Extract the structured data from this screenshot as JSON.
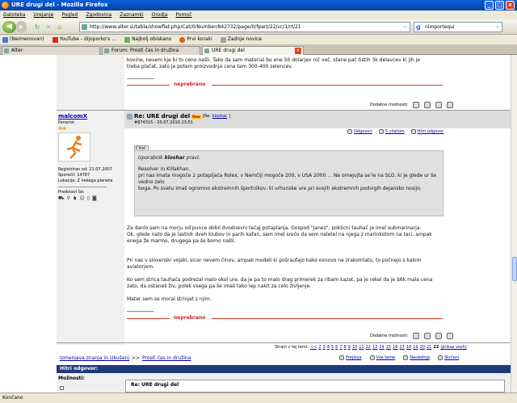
{
  "window": {
    "title": "URE drugi del - Mozilla Firefox"
  },
  "menu": [
    "Datoteka",
    "Urejanje",
    "Pogled",
    "Zgodovina",
    "Zaznamki",
    "Orodja",
    "Pomoč"
  ],
  "navbar": {
    "url": "http://www.alter.si/tabla/showflat.php/Cat/0/Number/842732/page/0/fpart/22/vc/1/rt/21",
    "search_value": "nimportequi"
  },
  "bookmarks": [
    {
      "label": "(Neimenovan)",
      "color": "#4a7bd0"
    },
    {
      "label": "YouTube - dijoporko's ...",
      "color": "#d22"
    },
    {
      "label": "Najbolj obiskano",
      "color": "#7a6"
    },
    {
      "label": "Prvi koraki",
      "color": "#e55b13"
    },
    {
      "label": "Zadnje novice",
      "color": "#9aa"
    }
  ],
  "tabs": [
    {
      "label": "Alter"
    },
    {
      "label": "Forum: Prosti čas in družina"
    },
    {
      "label": "URE drugi del"
    }
  ],
  "prev_post": {
    "text_line1": "kovine, nevem kje bi to ceno našli. Tako da sam material bo ene 50 dolarjev nič več, stane pač tistih 3k delavcev ki jih je",
    "text_line2": "treba plačat, zato je potem proizvodnja cena tam 300-400 zelencev.",
    "dashes": "--------------------",
    "unread_label": "neprebrano",
    "options_label": "Dodatne možnosti:"
  },
  "post": {
    "user": {
      "name": "malcomX",
      "rank": "Panerist",
      "registered": "Registriran od: 21.07.2007",
      "messages": "Sporočil: 14787",
      "location": "Lokacija: Z nekega planeta",
      "introduce": "Predstavi Se:"
    },
    "title": "Re: URE drugi del",
    "new_badge": "New",
    "reply_to": "[Re:",
    "reply_user": "kloshar",
    "reply_close": "]",
    "meta": "#874315 - 20.07.2010 23:51",
    "actions": {
      "reply": "Odgovori",
      "quote": "S citatom",
      "quick": "Hitri odgovor"
    },
    "quote": {
      "label": "Citat:",
      "author_prefix": "Uporabnik",
      "author": "kloshar",
      "author_suffix": "pravi:",
      "line1": "Resolver in Killakhan,",
      "line2": "pri nas imata mogoče 2 potapljača Rolex, v Nemčiji mogoče 200, v USA 2000 ... Ne omejujta se le na SLO, ki je glede ur še vedno zelo",
      "line3": "boga. Po svetu imaš ogromno ekstremnih športnikov, ki vrhunske ure pri svojih ekstremnih podvigih dejansko nosijo."
    },
    "body": [
      "Za danlo sem na morju od punce dobil dvodnevni tečaj potaplanja. Gospod \"Janez\", poklicni tauhač je imel submarinarja.",
      "Ok, glede nato da je lastnik dveh klubov in parih kafan, sem imel srečo da sem naletel na njega z marinkotom na taci, ampak",
      "enega že marmo, drugega pa še bomo našli.",
      "Pri nas v slovenski vojski, sicer nevem činov, ampak modeli ki pošraufajo kako osnovo na zrakomlatu, to počnejo s kakim",
      "aviatorjem.",
      "Ko sem strica tauhača podrezal malo okol ure, da je pa to malo drag primerek za ribam kazat, pa je rekel da je $6k mala cena",
      "zato, da ostaneš živ, polek vsega pa še imaš tako lep nakit za celo življenje.",
      "Mater sem se moral strinjat z njim."
    ],
    "dashes": "--------------------",
    "unread_label": "neprebrano",
    "options_label": "Dodatne možnosti:"
  },
  "pagination": {
    "label": "Strani v tej temi:",
    "prev": "<<",
    "pages": [
      "2",
      "3",
      "4",
      "5",
      "6",
      "7",
      "8",
      "9",
      "10",
      "11",
      "12",
      "13",
      "14",
      "15",
      "16",
      "17",
      "18",
      "19",
      "20",
      "21"
    ],
    "current": "22",
    "all": "(prikaz vseh)"
  },
  "breadcrumb": {
    "part1": "Izmenjava znanja in izkušenj",
    "sep": ">>",
    "part2": "Prosti čas in družina"
  },
  "thread_nav": {
    "prev": "Prejšnja",
    "all": "Vse teme",
    "next": "Naslednja",
    "collapse": "Skrčeni"
  },
  "quick_reply": {
    "header": "Hitri odgovor:",
    "options": "Možnosti:",
    "subject": "Re: URE drugi del"
  },
  "status": "Končano",
  "colors": {
    "accent_red": "#e23a2a",
    "link": "#0000aa",
    "header_blue": "#1f3a7c"
  }
}
